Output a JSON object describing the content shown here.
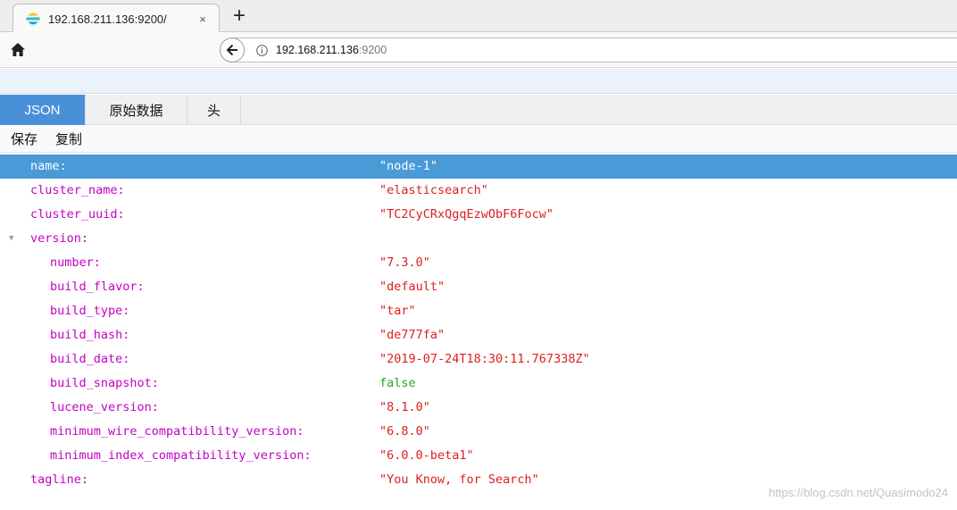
{
  "browser": {
    "tab_title": "192.168.211.136:9200/",
    "tab_close": "×",
    "new_tab": "+",
    "url_host": "192.168.211.136",
    "url_port": ":9200"
  },
  "viewer": {
    "tabs": [
      {
        "label": "JSON",
        "active": true
      },
      {
        "label": "原始数据",
        "active": false
      },
      {
        "label": "头",
        "active": false
      }
    ],
    "actions": {
      "save": "保存",
      "copy": "复制"
    }
  },
  "json": {
    "name": {
      "key": "name:",
      "value": "\"node-1\""
    },
    "cluster_name": {
      "key": "cluster_name:",
      "value": "\"elasticsearch\""
    },
    "cluster_uuid": {
      "key": "cluster_uuid:",
      "value": "\"TC2CyCRxQgqEzwObF6Focw\""
    },
    "version": {
      "key": "version:"
    },
    "number": {
      "key": "number:",
      "value": "\"7.3.0\""
    },
    "build_flavor": {
      "key": "build_flavor:",
      "value": "\"default\""
    },
    "build_type": {
      "key": "build_type:",
      "value": "\"tar\""
    },
    "build_hash": {
      "key": "build_hash:",
      "value": "\"de777fa\""
    },
    "build_date": {
      "key": "build_date:",
      "value": "\"2019-07-24T18:30:11.767338Z\""
    },
    "build_snapshot": {
      "key": "build_snapshot:",
      "value": "false"
    },
    "lucene_version": {
      "key": "lucene_version:",
      "value": "\"8.1.0\""
    },
    "minimum_wire_compatibility_version": {
      "key": "minimum_wire_compatibility_version:",
      "value": "\"6.8.0\""
    },
    "minimum_index_compatibility_version": {
      "key": "minimum_index_compatibility_version:",
      "value": "\"6.0.0-beta1\""
    },
    "tagline": {
      "key": "tagline:",
      "value": "\"You Know, for Search\""
    }
  },
  "watermark": "https://blog.csdn.net/Quasimodo24",
  "colors": {
    "accent": "#4a90d9",
    "selected_row": "#4a9ad8",
    "key": "#c400c4",
    "string_value": "#dd1f1f",
    "boolean_value": "#27a327"
  },
  "icons": {
    "favicon": "elasticsearch-favicon",
    "home": "home-icon",
    "back": "back-arrow-icon",
    "info": "info-icon",
    "twisty": "triangle-down-icon"
  }
}
